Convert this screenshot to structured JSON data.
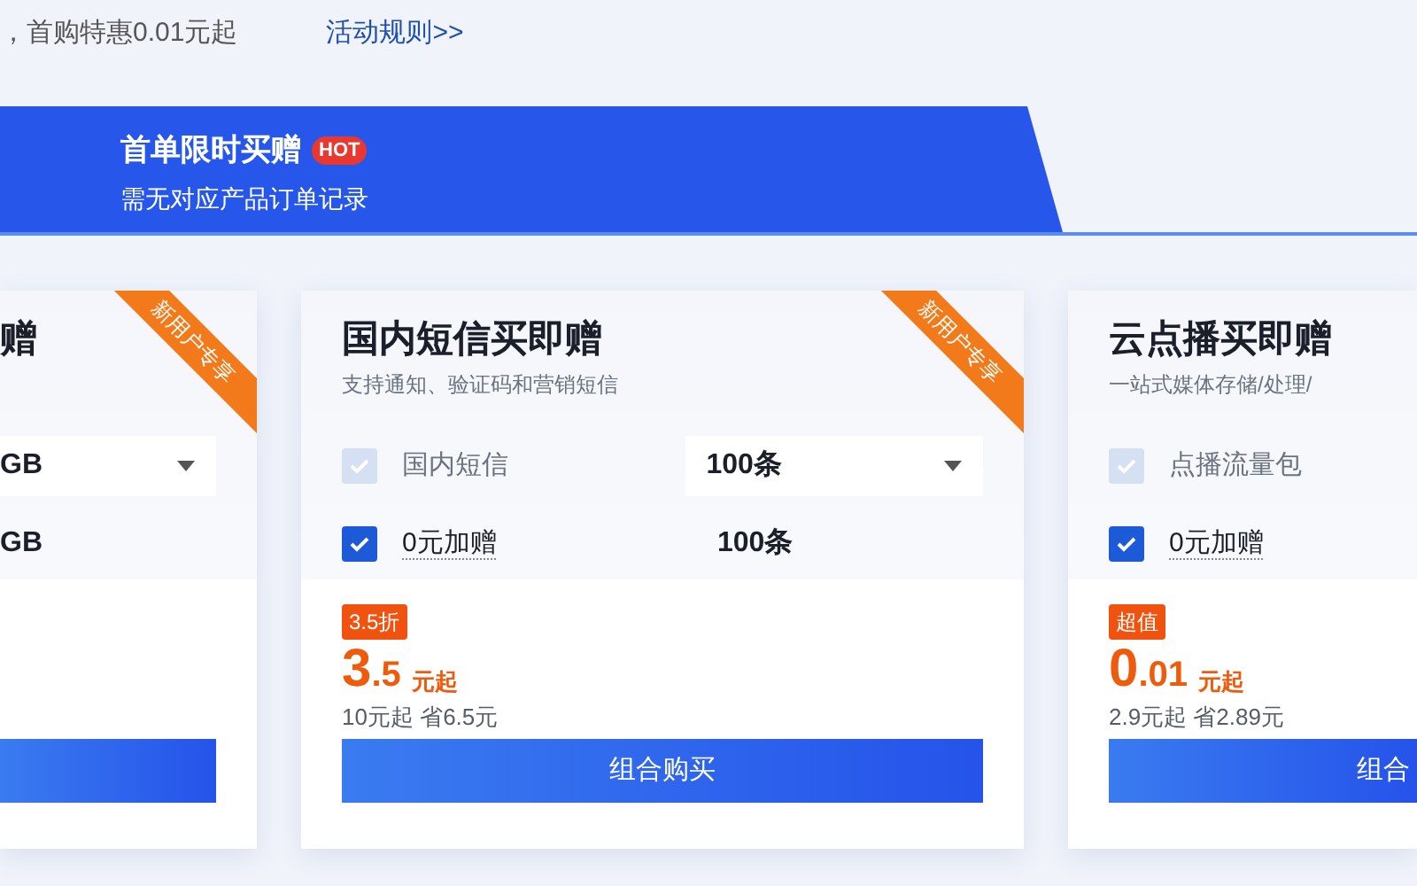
{
  "promo": {
    "text": "，首购特惠0.01元起",
    "link": "活动规则>>"
  },
  "tab": {
    "title": "首单限时买赠",
    "badge": "HOT",
    "subtitle": "需无对应产品订单记录",
    "selected": true
  },
  "cards": [
    {
      "kind": "cut-left",
      "title": "赠",
      "ribbon": "新用户专享",
      "rows": [
        {
          "kind": "select",
          "value": "GB"
        },
        {
          "kind": "text",
          "value": "GB"
        }
      ]
    },
    {
      "kind": "full",
      "title": "国内短信买即赠",
      "subtitle": "支持通知、验证码和营销短信",
      "ribbon": "新用户专享",
      "rows": [
        {
          "kind": "check",
          "label": "国内短信",
          "checked": true,
          "disabled": true,
          "select": "100条"
        },
        {
          "kind": "check",
          "label": "0元加赠",
          "checked": true,
          "disabled": false,
          "amount": "100条"
        }
      ],
      "tag": "3.5折",
      "price_int": "3",
      "price_dec": ".5",
      "unit": "元起",
      "original": "10元起 省6.5元",
      "button": "组合购买"
    },
    {
      "kind": "cut-right",
      "title": "云点播买即赠",
      "subtitle": "一站式媒体存储/处理/",
      "rows": [
        {
          "kind": "check",
          "label": "点播流量包",
          "checked": true,
          "disabled": true
        },
        {
          "kind": "check",
          "label": "0元加赠",
          "checked": true,
          "disabled": false
        }
      ],
      "tag": "超值",
      "price_int": "0",
      "price_dec": ".01",
      "unit": "元起",
      "original": "2.9元起 省2.89元",
      "button": "组合"
    }
  ]
}
